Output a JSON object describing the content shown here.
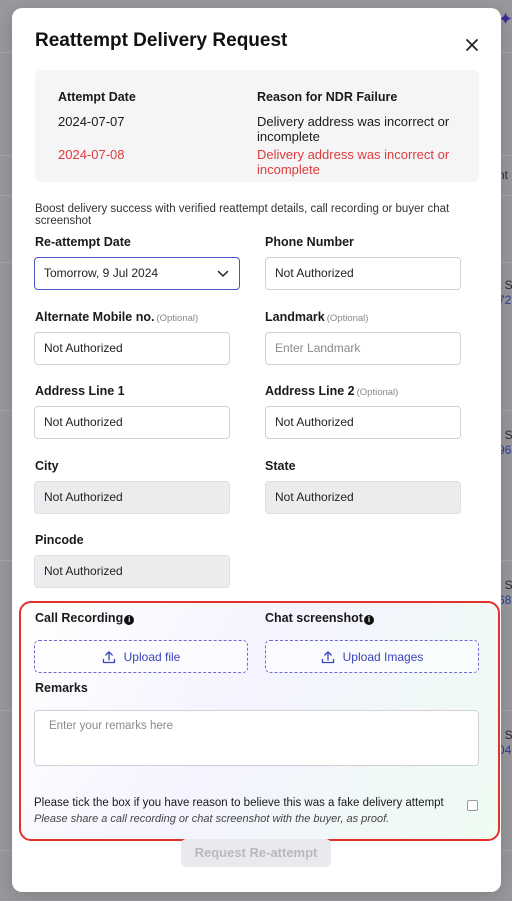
{
  "modal": {
    "title": "Reattempt Delivery Request"
  },
  "ndr_table": {
    "headers": [
      "Attempt Date",
      "Reason for NDR Failure"
    ],
    "rows": [
      {
        "date": "2024-07-07",
        "reason": "Delivery address was incorrect or incomplete",
        "highlight": false
      },
      {
        "date": "2024-07-08",
        "reason": "Delivery address was incorrect or incomplete",
        "highlight": true
      }
    ],
    "highlight_color": "#dc3b3b"
  },
  "hint": "Boost delivery success with verified reattempt details, call recording or buyer chat screenshot",
  "form": {
    "reattempt_date": {
      "label": "Re-attempt Date",
      "value": "Tomorrow, 9 Jul 2024"
    },
    "phone": {
      "label": "Phone Number",
      "value": "Not Authorized"
    },
    "alt_mobile": {
      "label": "Alternate Mobile no.",
      "optional": "(Optional)",
      "value": "Not Authorized"
    },
    "landmark": {
      "label": "Landmark",
      "optional": "(Optional)",
      "placeholder": "Enter Landmark"
    },
    "address1": {
      "label": "Address Line 1",
      "value": "Not Authorized"
    },
    "address2": {
      "label": "Address Line 2",
      "optional": "(Optional)",
      "value": "Not Authorized"
    },
    "city": {
      "label": "City",
      "value": "Not Authorized"
    },
    "state": {
      "label": "State",
      "value": "Not Authorized"
    },
    "pincode": {
      "label": "Pincode",
      "value": "Not Authorized"
    }
  },
  "proof": {
    "call_recording_label": "Call Recording",
    "chat_screenshot_label": "Chat screenshot",
    "info_glyph": "i",
    "upload_file_label": "Upload file",
    "upload_images_label": "Upload Images",
    "remarks_label": "Remarks",
    "remarks_placeholder": "Enter your remarks here",
    "fake_attempt_text": "Please tick the box if you have reason to believe this was a fake delivery attempt",
    "fake_attempt_subtext": "Please share a call recording or chat screenshot with the buyer, as proof.",
    "fake_attempt_checked": false,
    "highlight_border_color": "#e3312b"
  },
  "submit_label": "Request Re-attempt",
  "background": {
    "right_edge_texts": [
      "nt I",
      "t Sc",
      "72",
      "t Sc",
      "96",
      "t Sc",
      "68",
      "t Sc",
      "04"
    ]
  },
  "colors": {
    "accent": "#4a55c8",
    "link": "#3a43b8"
  }
}
